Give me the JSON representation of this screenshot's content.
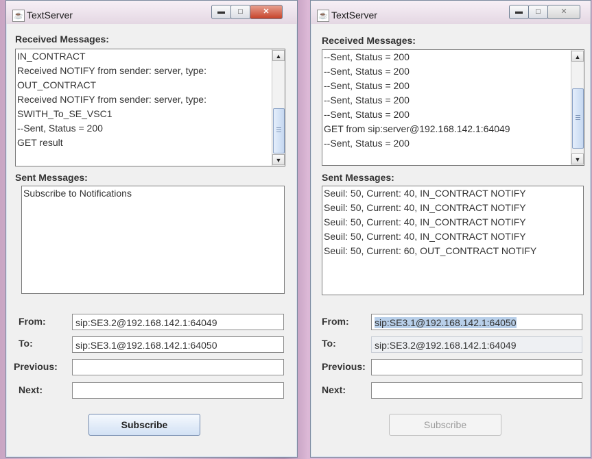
{
  "windows": [
    {
      "title": "TextServer",
      "received_label": "Received Messages:",
      "received": [
        "IN_CONTRACT",
        "Received NOTIFY from sender: server, type:",
        "OUT_CONTRACT",
        "Received NOTIFY from sender: server, type:",
        "SWITH_To_SE_VSC1",
        "--Sent, Status = 200",
        "GET result"
      ],
      "sent_label": "Sent Messages:",
      "sent": [
        "Subscribe to Notifications"
      ],
      "from_label": "From:",
      "from_value": "sip:SE3.2@192.168.142.1:64049",
      "to_label": "To:",
      "to_value": "sip:SE3.1@192.168.142.1:64050",
      "previous_label": "Previous:",
      "previous_value": "",
      "next_label": "Next:",
      "next_value": "",
      "subscribe_label": "Subscribe"
    },
    {
      "title": "TextServer",
      "received_label": "Received Messages:",
      "received": [
        "--Sent, Status = 200",
        "--Sent, Status = 200",
        "--Sent, Status = 200",
        "--Sent, Status = 200",
        "--Sent, Status = 200",
        "GET from sip:server@192.168.142.1:64049",
        "--Sent, Status = 200"
      ],
      "sent_label": "Sent Messages:",
      "sent": [
        "Seuil: 50, Current: 40, IN_CONTRACT NOTIFY",
        "Seuil: 50, Current: 40, IN_CONTRACT NOTIFY",
        "Seuil: 50, Current: 40, IN_CONTRACT NOTIFY",
        "Seuil: 50, Current: 40, IN_CONTRACT NOTIFY",
        "Seuil: 50, Current: 60, OUT_CONTRACT NOTIFY"
      ],
      "from_label": "From:",
      "from_value": "sip:SE3.1@192.168.142.1:64050",
      "to_label": "To:",
      "to_value": "sip:SE3.2@192.168.142.1:64049",
      "previous_label": "Previous:",
      "previous_value": "",
      "next_label": "Next:",
      "next_value": "",
      "subscribe_label": "Subscribe"
    }
  ],
  "icons": {
    "app": "java-app-icon",
    "minimize": "minimize-icon",
    "maximize": "maximize-icon",
    "close": "close-icon",
    "scroll_up": "arrow-up-icon",
    "scroll_down": "arrow-down-icon"
  }
}
